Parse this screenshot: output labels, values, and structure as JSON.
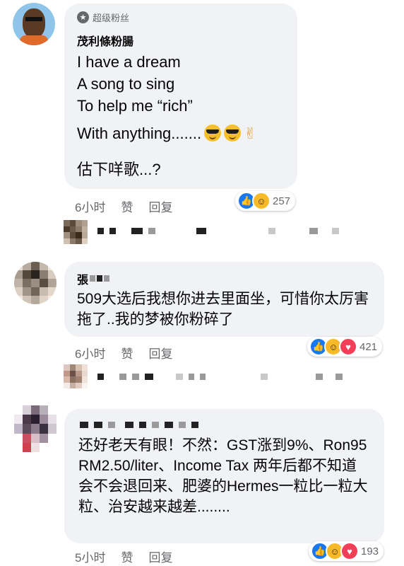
{
  "comments": [
    {
      "badge": "超级粉丝",
      "author": "茂利條粉腸",
      "lines": [
        "I have a dream",
        "A song to sing",
        "To help me “rich”"
      ],
      "last_line": "With anything.......",
      "extra": "估下咩歌...?",
      "time": "6小时",
      "like_label": "赞",
      "reply_label": "回复",
      "reaction_count": "257"
    },
    {
      "author_partial": "張",
      "text": "509大选后我想你进去里面坐，可惜你太厉害拖了..我的梦被你粉碎了",
      "time": "6小时",
      "like_label": "赞",
      "reply_label": "回复",
      "reaction_count": "421"
    },
    {
      "text": "还好老天有眼！不然：GST涨到9%、Ron95 RM2.50/liter、Income Tax 两年后都不知道会不会退回来、肥婆的Hermes一粒比一粒大粒、治安越来越差........",
      "time": "5小时",
      "like_label": "赞",
      "reply_label": "回复",
      "reaction_count": "193"
    }
  ],
  "icons": {
    "badge": "fan-badge-icon",
    "like": "like-reaction-icon",
    "haha": "haha-reaction-icon",
    "love": "love-reaction-icon",
    "sunglasses": "sunglasses-emoji-icon",
    "rock_hand": "rock-hand-emoji-icon"
  },
  "colors": {
    "bubble": "#f0f2f5",
    "meta_text": "#65676b",
    "like_blue": "#1877f2",
    "haha_yellow": "#f7b928",
    "love_red": "#f33e58"
  }
}
